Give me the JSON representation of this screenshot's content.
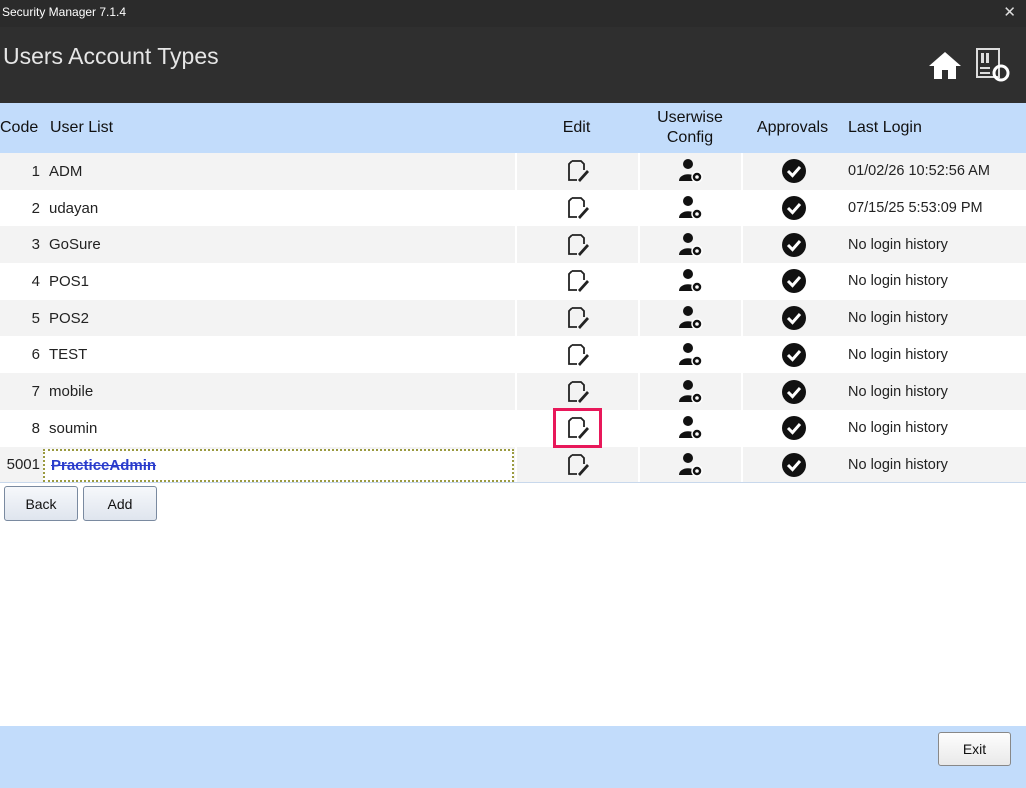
{
  "window": {
    "title": "Security Manager 7.1.4",
    "close_icon": "close-icon"
  },
  "header": {
    "title": "Users Account Types",
    "icons": [
      "home-icon",
      "refresh-config-icon"
    ]
  },
  "table": {
    "columns": {
      "code": "Code",
      "user_list": "User List",
      "edit": "Edit",
      "config": "Userwise Config",
      "approvals": "Approvals",
      "last_login": "Last Login"
    },
    "rows": [
      {
        "code": "1",
        "name": "ADM",
        "last_login": "01/02/26 10:52:56 AM"
      },
      {
        "code": "2",
        "name": "udayan",
        "last_login": "07/15/25 5:53:09 PM"
      },
      {
        "code": "3",
        "name": "GoSure",
        "last_login": "No login history"
      },
      {
        "code": "4",
        "name": "POS1",
        "last_login": "No login history"
      },
      {
        "code": "5",
        "name": "POS2",
        "last_login": "No login history"
      },
      {
        "code": "6",
        "name": "TEST",
        "last_login": "No login history"
      },
      {
        "code": "7",
        "name": "mobile",
        "last_login": "No login history"
      },
      {
        "code": "8",
        "name": "soumin",
        "last_login": "No login history"
      },
      {
        "code": "5001",
        "name": "PracticeAdmin",
        "last_login": "No login history",
        "editing": true
      }
    ]
  },
  "buttons": {
    "back": "Back",
    "add": "Add",
    "exit": "Exit"
  },
  "colors": {
    "header_bg": "#2f2f2f",
    "table_header_bg": "#c2dcfb",
    "highlight": "#e8185a",
    "edit_text": "#2a3ccc"
  }
}
